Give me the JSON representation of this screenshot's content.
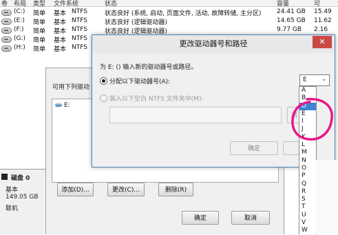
{
  "volume_table": {
    "headers": [
      "卷",
      "布局",
      "类型",
      "文件系统",
      "状态",
      "容量",
      "可"
    ],
    "rows": [
      {
        "vol": "(C:)",
        "layout": "简单",
        "type": "基本",
        "fs": "NTFS",
        "status": "状态良好 (系统, 启动, 页面文件, 活动, 故障转储, 主分区)",
        "capacity": "24.41 GB",
        "free": "15.49"
      },
      {
        "vol": "(E:)",
        "layout": "简单",
        "type": "基本",
        "fs": "NTFS",
        "status": "状态良好 (逻辑驱动器)",
        "capacity": "14.65 GB",
        "free": "11.62"
      },
      {
        "vol": "(F:)",
        "layout": "简单",
        "type": "基本",
        "fs": "NTFS",
        "status": "状态良好 (逻辑驱动器)",
        "capacity": "9.77 GB",
        "free": "2.16"
      },
      {
        "vol": "(G:)",
        "layout": "简单",
        "type": "基本",
        "fs": "NTFS",
        "status": "",
        "capacity": "",
        "free": ""
      },
      {
        "vol": "(H:)",
        "layout": "简单",
        "type": "基本",
        "fs": "NTFS",
        "status": "",
        "capacity": "",
        "free": ""
      }
    ]
  },
  "disk_panel": {
    "name": "磁盘 0",
    "type": "基本",
    "size": "149.05 GB",
    "state": "联机"
  },
  "outer_dialog": {
    "label": "可用下列驱动",
    "list_item": "E:",
    "add_button": "添加(D)...",
    "change_button": "更改(C)...",
    "delete_button": "删除(R)",
    "ok_button": "确定",
    "cancel_button": "取消"
  },
  "inner_dialog": {
    "title": "更改驱动器号和路径",
    "close_glyph": "✕",
    "intro": "为 E: () 输入新的驱动器号或路径。",
    "option_assign": "分配以下驱动器号(A):",
    "option_mount": "装入以下空白 NTFS 文件夹中(M):",
    "browse_button": "浏",
    "ok_button": "确定",
    "cancel_partial": "",
    "selected_letter": "E"
  },
  "dropdown": {
    "letters": [
      "A",
      "B",
      "D",
      "E",
      "I",
      "J",
      "K",
      "L",
      "M",
      "N",
      "O",
      "P",
      "Q",
      "R",
      "S",
      "T",
      "U",
      "V",
      "W"
    ],
    "highlighted": "D"
  },
  "colors": {
    "accent": "#3d82d6",
    "annotation": "#e8178a"
  }
}
